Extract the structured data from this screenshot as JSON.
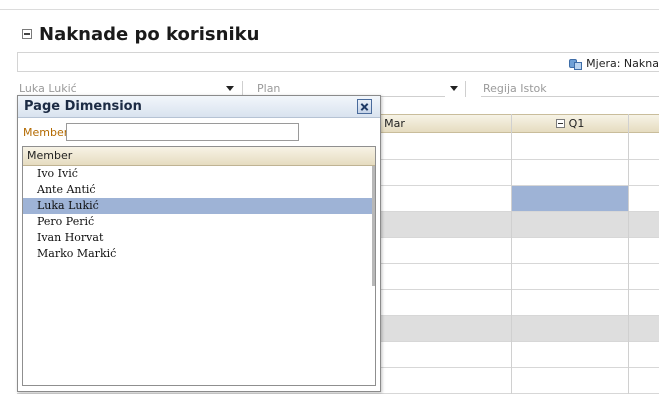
{
  "header": {
    "title": "Naknade po korisniku"
  },
  "toolbar": {
    "measure_label": "Mjera: Nakna"
  },
  "pov": {
    "user": "Luka Lukić",
    "scenario": "Plan",
    "region": "Regija Istok"
  },
  "grid": {
    "columns": [
      {
        "label": "Mar"
      },
      {
        "label": "Q1"
      }
    ]
  },
  "popup": {
    "title": "Page Dimension",
    "search_label": "Member",
    "search_value": "",
    "list_header": "Member",
    "items": [
      {
        "label": "Ivo Ivić",
        "selected": false
      },
      {
        "label": "Ante Antić",
        "selected": false
      },
      {
        "label": "Luka Lukić",
        "selected": true
      },
      {
        "label": "Pero Perić",
        "selected": false
      },
      {
        "label": "Ivan Horvat",
        "selected": false
      },
      {
        "label": "Marko Markić",
        "selected": false
      }
    ]
  }
}
